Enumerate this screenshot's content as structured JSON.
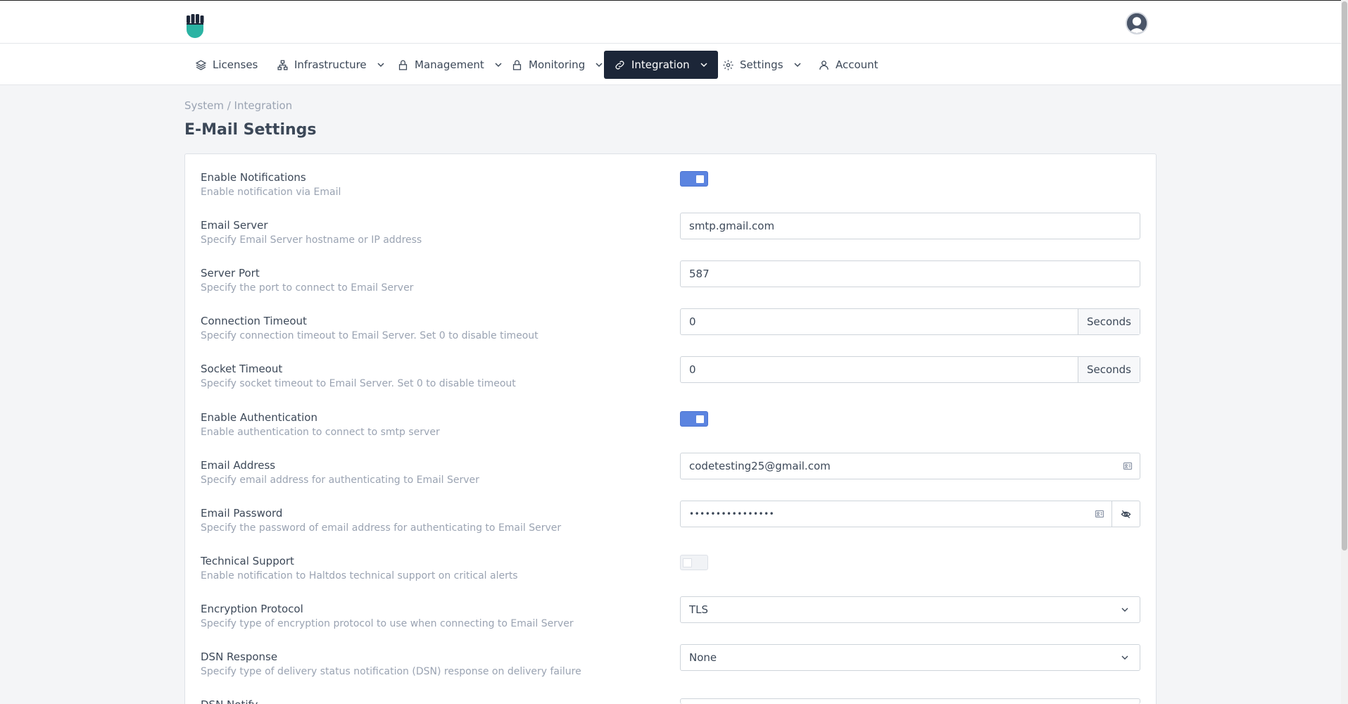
{
  "nav": {
    "items": [
      {
        "label": "Licenses",
        "icon": "layers-icon",
        "dropdown": false
      },
      {
        "label": "Infrastructure",
        "icon": "network-icon",
        "dropdown": true
      },
      {
        "label": "Management",
        "icon": "lock-icon",
        "dropdown": true
      },
      {
        "label": "Monitoring",
        "icon": "lock-icon",
        "dropdown": true
      },
      {
        "label": "Integration",
        "icon": "link-icon",
        "dropdown": true,
        "active": true
      },
      {
        "label": "Settings",
        "icon": "gear-icon",
        "dropdown": true
      },
      {
        "label": "Account",
        "icon": "user-icon",
        "dropdown": false
      }
    ]
  },
  "breadcrumb": "System / Integration",
  "page_title": "E-Mail Settings",
  "settings": [
    {
      "label": "Enable Notifications",
      "desc": "Enable notification via Email",
      "type": "toggle",
      "on": true
    },
    {
      "label": "Email Server",
      "desc": "Specify Email Server hostname or IP address",
      "type": "text",
      "value": "smtp.gmail.com"
    },
    {
      "label": "Server Port",
      "desc": "Specify the port to connect to Email Server",
      "type": "text",
      "value": "587"
    },
    {
      "label": "Connection Timeout",
      "desc": "Specify connection timeout to Email Server. Set 0 to disable timeout",
      "type": "addon",
      "value": "0",
      "addon": "Seconds"
    },
    {
      "label": "Socket Timeout",
      "desc": "Specify socket timeout to Email Server. Set 0 to disable timeout",
      "type": "addon",
      "value": "0",
      "addon": "Seconds"
    },
    {
      "label": "Enable Authentication",
      "desc": "Enable authentication to connect to smtp server",
      "type": "toggle",
      "on": true
    },
    {
      "label": "Email Address",
      "desc": "Specify email address for authenticating to Email Server",
      "type": "email",
      "value": "codetesting25@gmail.com"
    },
    {
      "label": "Email Password",
      "desc": "Specify the password of email address for authenticating to Email Server",
      "type": "password",
      "value": "••••••••••••••••"
    },
    {
      "label": "Technical Support",
      "desc": "Enable notification to Haltdos technical support on critical alerts",
      "type": "toggle",
      "on": false
    },
    {
      "label": "Encryption Protocol",
      "desc": "Specify type of encryption protocol to use when connecting to Email Server",
      "type": "select",
      "value": "TLS"
    },
    {
      "label": "DSN Response",
      "desc": "Specify type of delivery status notification (DSN) response on delivery failure",
      "type": "select",
      "value": "None"
    },
    {
      "label": "DSN Notify",
      "desc": "",
      "type": "select",
      "value": ""
    }
  ],
  "colors": {
    "accent": "#5b84e0",
    "nav_active": "#1c2638",
    "logo": "#2bb3a3"
  }
}
